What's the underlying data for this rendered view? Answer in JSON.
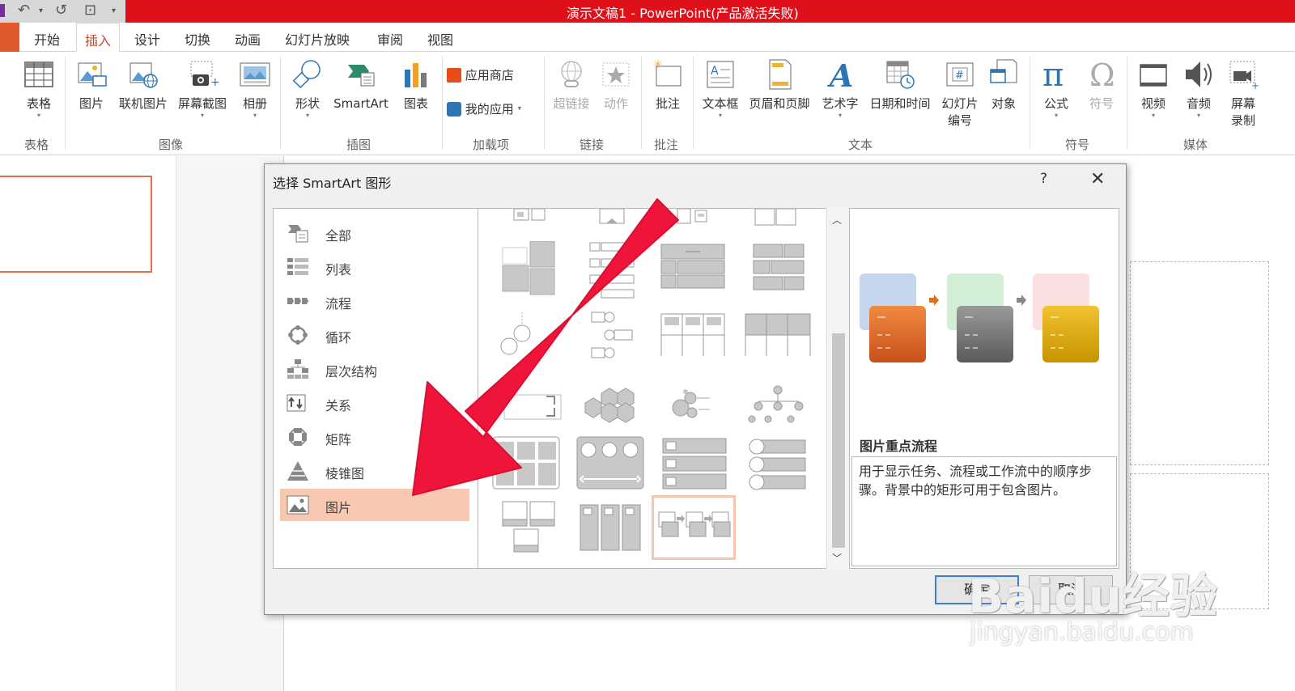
{
  "window": {
    "title": "演示文稿1 - PowerPoint(产品激活失败)"
  },
  "menu_tabs": [
    {
      "label": "开始"
    },
    {
      "label": "插入",
      "active": true
    },
    {
      "label": "设计"
    },
    {
      "label": "切换"
    },
    {
      "label": "动画"
    },
    {
      "label": "幻灯片放映"
    },
    {
      "label": "审阅"
    },
    {
      "label": "视图"
    }
  ],
  "ribbon": {
    "buttons": [
      {
        "label": "表格",
        "icon": "table-icon"
      },
      {
        "label": "图片",
        "icon": "picture-icon"
      },
      {
        "label": "联机图片",
        "icon": "online-picture-icon"
      },
      {
        "label": "屏幕截图",
        "icon": "screenshot-icon"
      },
      {
        "label": "相册",
        "icon": "photo-album-icon"
      },
      {
        "label": "形状",
        "icon": "shapes-icon"
      },
      {
        "label": "SmartArt",
        "icon": "smartart-icon"
      },
      {
        "label": "图表",
        "icon": "chart-icon"
      },
      {
        "label": "应用商店",
        "icon": "store-icon"
      },
      {
        "label": "我的应用",
        "icon": "my-apps-icon"
      },
      {
        "label": "超链接",
        "icon": "hyperlink-icon",
        "disabled": true
      },
      {
        "label": "动作",
        "icon": "action-icon",
        "disabled": true
      },
      {
        "label": "批注",
        "icon": "comment-icon"
      },
      {
        "label": "文本框",
        "icon": "textbox-icon"
      },
      {
        "label": "页眉和页脚",
        "icon": "header-footer-icon"
      },
      {
        "label": "艺术字",
        "icon": "wordart-icon"
      },
      {
        "label": "日期和时间",
        "icon": "date-time-icon"
      },
      {
        "label": "幻灯片",
        "label2": "编号",
        "icon": "slide-number-icon"
      },
      {
        "label": "对象",
        "icon": "object-icon"
      },
      {
        "label": "公式",
        "icon": "equation-icon"
      },
      {
        "label": "符号",
        "icon": "symbol-icon",
        "disabled": true
      },
      {
        "label": "视频",
        "icon": "video-icon"
      },
      {
        "label": "音频",
        "icon": "audio-icon"
      },
      {
        "label": "屏幕",
        "label2": "录制",
        "icon": "screen-recording-icon"
      }
    ],
    "groups": [
      {
        "label": "表格"
      },
      {
        "label": "图像"
      },
      {
        "label": "插图"
      },
      {
        "label": "加载项"
      },
      {
        "label": "链接"
      },
      {
        "label": "批注"
      },
      {
        "label": "文本"
      },
      {
        "label": "符号"
      },
      {
        "label": "媒体"
      }
    ]
  },
  "dialog": {
    "title": "选择 SmartArt 图形",
    "help": "?",
    "close": "✕",
    "categories": [
      {
        "label": "全部",
        "icon": "all-icon"
      },
      {
        "label": "列表",
        "icon": "list-icon"
      },
      {
        "label": "流程",
        "icon": "process-icon"
      },
      {
        "label": "循环",
        "icon": "cycle-icon"
      },
      {
        "label": "层次结构",
        "icon": "hierarchy-icon"
      },
      {
        "label": "关系",
        "icon": "relationship-icon"
      },
      {
        "label": "矩阵",
        "icon": "matrix-icon"
      },
      {
        "label": "棱锥图",
        "icon": "pyramid-icon"
      },
      {
        "label": "图片",
        "icon": "picture-icon",
        "selected": true
      }
    ],
    "preview": {
      "name": "图片重点流程",
      "description": "用于显示任务、流程或工作流中的顺序步骤。背景中的矩形可用于包含图片。",
      "colors": [
        "#e07020",
        "#808080",
        "#d4a800"
      ]
    },
    "ok_label": "确定",
    "cancel_label": "取消"
  },
  "watermark": {
    "logo": "Baidu经验",
    "url": "jingyan.baidu.com"
  },
  "colors": {
    "titlebar": "#e0101a",
    "accent": "#d24726",
    "selection": "#f8c9b0",
    "arrow": "#f0143a"
  }
}
